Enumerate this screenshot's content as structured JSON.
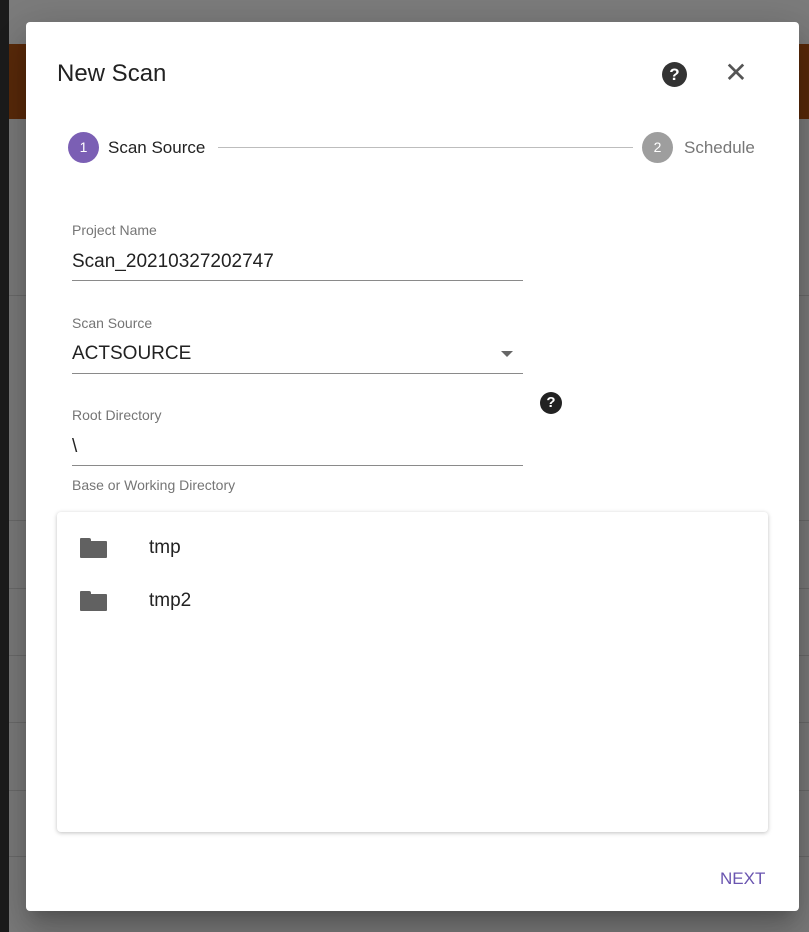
{
  "dialog": {
    "title": "New Scan",
    "next_label": "NEXT"
  },
  "stepper": {
    "steps": [
      {
        "number": "1",
        "label": "Scan Source",
        "active": true
      },
      {
        "number": "2",
        "label": "Schedule",
        "active": false
      }
    ]
  },
  "form": {
    "project_name": {
      "label": "Project Name",
      "value": "Scan_20210327202747"
    },
    "scan_source": {
      "label": "Scan Source",
      "value": "ACTSOURCE"
    },
    "root_directory": {
      "label": "Root Directory",
      "value": "\\",
      "hint": "Base or Working Directory"
    }
  },
  "folders": [
    {
      "name": "tmp",
      "icon": "folder-icon"
    },
    {
      "name": "tmp2",
      "icon": "folder-icon"
    }
  ],
  "icons": {
    "help": "help-icon",
    "close": "close-icon",
    "dropdown": "chevron-down-icon"
  },
  "colors": {
    "accent": "#7b5fb4",
    "inactive_step": "#9e9e9e",
    "next_button": "#6a55b0",
    "backdrop_header": "#5a2a0a"
  }
}
